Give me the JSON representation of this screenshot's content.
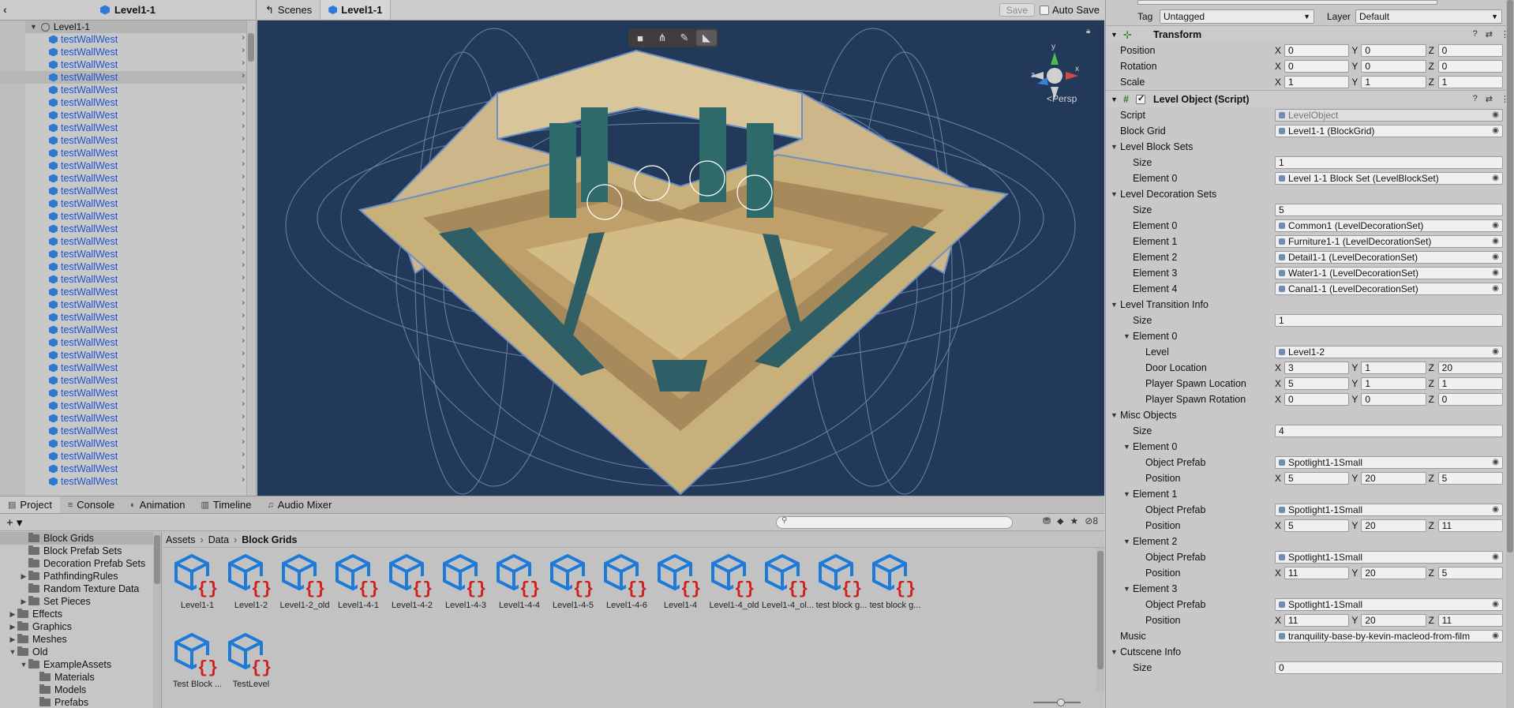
{
  "hierarchy": {
    "title": "Level1-1",
    "root": "Level1-1",
    "items": [
      "testWallWest",
      "testWallWest",
      "testWallWest",
      "testWallWest",
      "testWallWest",
      "testWallWest",
      "testWallWest",
      "testWallWest",
      "testWallWest",
      "testWallWest",
      "testWallWest",
      "testWallWest",
      "testWallWest",
      "testWallWest",
      "testWallWest",
      "testWallWest",
      "testWallWest",
      "testWallWest",
      "testWallWest",
      "testWallWest",
      "testWallWest",
      "testWallWest",
      "testWallWest",
      "testWallWest",
      "testWallWest",
      "testWallWest",
      "testWallWest",
      "testWallWest",
      "testWallWest",
      "testWallWest",
      "testWallWest",
      "testWallWest",
      "testWallWest",
      "testWallWest",
      "testWallWest",
      "testWallWest"
    ]
  },
  "scene": {
    "tab_scenes": "Scenes",
    "tab_level": "Level1-1",
    "save": "Save",
    "auto_save": "Auto Save",
    "persp": "<Persp",
    "gizmo_y": "y",
    "gizmo_x": "x",
    "gizmo_z": "z"
  },
  "project": {
    "tabs": [
      "Project",
      "Console",
      "Animation",
      "Timeline",
      "Audio Mixer"
    ],
    "hidden_count": "8",
    "tree": [
      {
        "label": "Block Grids",
        "indent": 2,
        "arrow": "",
        "sel": true
      },
      {
        "label": "Block Prefab Sets",
        "indent": 2,
        "arrow": ""
      },
      {
        "label": "Decoration Prefab Sets",
        "indent": 2,
        "arrow": ""
      },
      {
        "label": "PathfindingRules",
        "indent": 2,
        "arrow": "▶"
      },
      {
        "label": "Random Texture Data",
        "indent": 2,
        "arrow": ""
      },
      {
        "label": "Set Pieces",
        "indent": 2,
        "arrow": "▶"
      },
      {
        "label": "Effects",
        "indent": 1,
        "arrow": "▶"
      },
      {
        "label": "Graphics",
        "indent": 1,
        "arrow": "▶"
      },
      {
        "label": "Meshes",
        "indent": 1,
        "arrow": "▶"
      },
      {
        "label": "Old",
        "indent": 1,
        "arrow": "▼"
      },
      {
        "label": "ExampleAssets",
        "indent": 2,
        "arrow": "▼"
      },
      {
        "label": "Materials",
        "indent": 3,
        "arrow": ""
      },
      {
        "label": "Models",
        "indent": 3,
        "arrow": ""
      },
      {
        "label": "Prefabs",
        "indent": 3,
        "arrow": ""
      }
    ],
    "breadcrumb": [
      "Assets",
      "Data",
      "Block Grids"
    ],
    "assets": [
      "Level1-1",
      "Level1-2",
      "Level1-2_old",
      "Level1-4-1",
      "Level1-4-2",
      "Level1-4-3",
      "Level1-4-4",
      "Level1-4-5",
      "Level1-4-6",
      "Level1-4",
      "Level1-4_old",
      "Level1-4_ol...",
      "test block g...",
      "test block g...",
      "Test Block ...",
      "TestLevel"
    ]
  },
  "inspector": {
    "tag_label": "Tag",
    "tag_value": "Untagged",
    "layer_label": "Layer",
    "layer_value": "Default",
    "transform": {
      "title": "Transform",
      "rows": [
        {
          "label": "Position",
          "x": "0",
          "y": "0",
          "z": "0"
        },
        {
          "label": "Rotation",
          "x": "0",
          "y": "0",
          "z": "0"
        },
        {
          "label": "Scale",
          "x": "1",
          "y": "1",
          "z": "1"
        }
      ]
    },
    "level_object": {
      "title": "Level Object (Script)",
      "script_label": "Script",
      "script_value": "LevelObject",
      "block_grid_label": "Block Grid",
      "block_grid_value": "Level1-1 (BlockGrid)",
      "block_sets_label": "Level Block Sets",
      "block_sets_size": "1",
      "block_sets": [
        "Level 1-1 Block Set (LevelBlockSet)"
      ],
      "deco_label": "Level Decoration Sets",
      "deco_size": "5",
      "deco": [
        "Common1 (LevelDecorationSet)",
        "Furniture1-1 (LevelDecorationSet)",
        "Detail1-1 (LevelDecorationSet)",
        "Water1-1 (LevelDecorationSet)",
        "Canal1-1 (LevelDecorationSet)"
      ],
      "transition_label": "Level Transition Info",
      "transition_size": "1",
      "transition_element": "Element 0",
      "transition_level_label": "Level",
      "transition_level": "Level1-2",
      "door_label": "Door Location",
      "door": {
        "x": "3",
        "y": "1",
        "z": "20"
      },
      "spawn_label": "Player Spawn Location",
      "spawn": {
        "x": "5",
        "y": "1",
        "z": "1"
      },
      "spawn_rot_label": "Player Spawn Rotation",
      "spawn_rot": {
        "x": "0",
        "y": "0",
        "z": "0"
      },
      "misc_label": "Misc Objects",
      "misc_size": "4",
      "misc": [
        {
          "name": "Element 0",
          "prefab": "Spotlight1-1Small",
          "x": "5",
          "y": "20",
          "z": "5"
        },
        {
          "name": "Element 1",
          "prefab": "Spotlight1-1Small",
          "x": "5",
          "y": "20",
          "z": "11"
        },
        {
          "name": "Element 2",
          "prefab": "Spotlight1-1Small",
          "x": "11",
          "y": "20",
          "z": "5"
        },
        {
          "name": "Element 3",
          "prefab": "Spotlight1-1Small",
          "x": "11",
          "y": "20",
          "z": "11"
        }
      ],
      "object_prefab_label": "Object Prefab",
      "position_label": "Position",
      "size_label": "Size",
      "music_label": "Music",
      "music_value": "tranquility-base-by-kevin-macleod-from-film",
      "cutscene_label": "Cutscene Info",
      "cutscene_size": "0"
    }
  }
}
